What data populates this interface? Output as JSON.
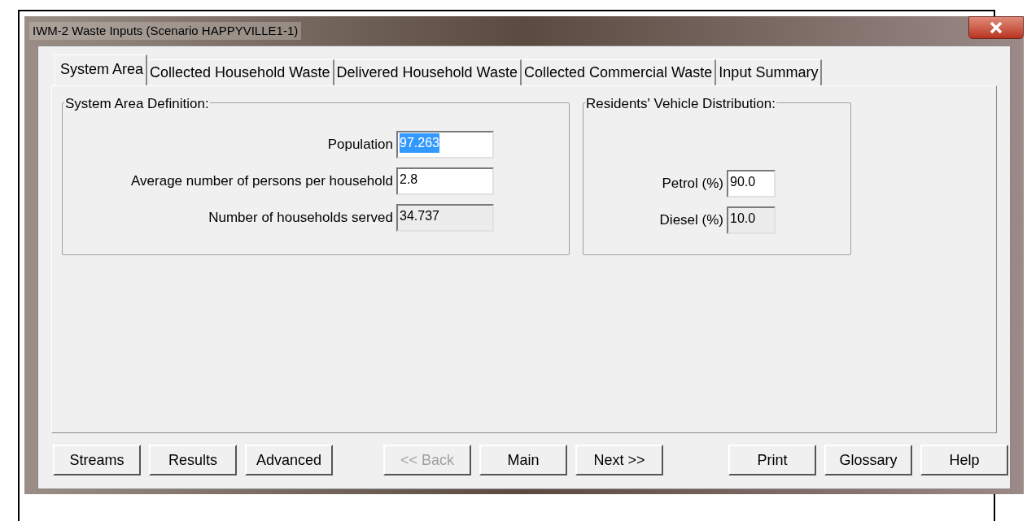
{
  "window": {
    "title": "IWM-2 Waste Inputs (Scenario HAPPYVILLE1-1)"
  },
  "tabs": [
    {
      "label": "System Area",
      "selected": true
    },
    {
      "label": "Collected Household Waste",
      "selected": false
    },
    {
      "label": "Delivered Household Waste",
      "selected": false
    },
    {
      "label": "Collected Commercial Waste",
      "selected": false
    },
    {
      "label": "Input Summary",
      "selected": false
    }
  ],
  "groups": [
    {
      "title": "System Area Definition:",
      "fields": [
        {
          "label": "Population",
          "value": "97.263",
          "disabled": false,
          "highlighted": true
        },
        {
          "label": "Average number of persons per household",
          "value": "2.8",
          "disabled": false,
          "highlighted": false
        },
        {
          "label": "Number of households served",
          "value": "34.737",
          "disabled": true,
          "highlighted": false
        }
      ]
    },
    {
      "title": "Residents' Vehicle Distribution:",
      "fields": [
        {
          "label": "Petrol (%)",
          "value": "90.0",
          "disabled": false,
          "highlighted": false
        },
        {
          "label": "Diesel (%)",
          "value": "10.0",
          "disabled": true,
          "highlighted": false
        }
      ]
    }
  ],
  "button_groups": [
    [
      {
        "label": "Streams",
        "disabled": false
      },
      {
        "label": "Results",
        "disabled": false
      },
      {
        "label": "Advanced",
        "disabled": false
      }
    ],
    [
      {
        "label": "<< Back",
        "disabled": true
      },
      {
        "label": "Main",
        "disabled": false
      },
      {
        "label": "Next >>",
        "disabled": false
      }
    ],
    [
      {
        "label": "Print",
        "disabled": false
      },
      {
        "label": "Glossary",
        "disabled": false
      },
      {
        "label": "Help",
        "disabled": false
      }
    ]
  ]
}
